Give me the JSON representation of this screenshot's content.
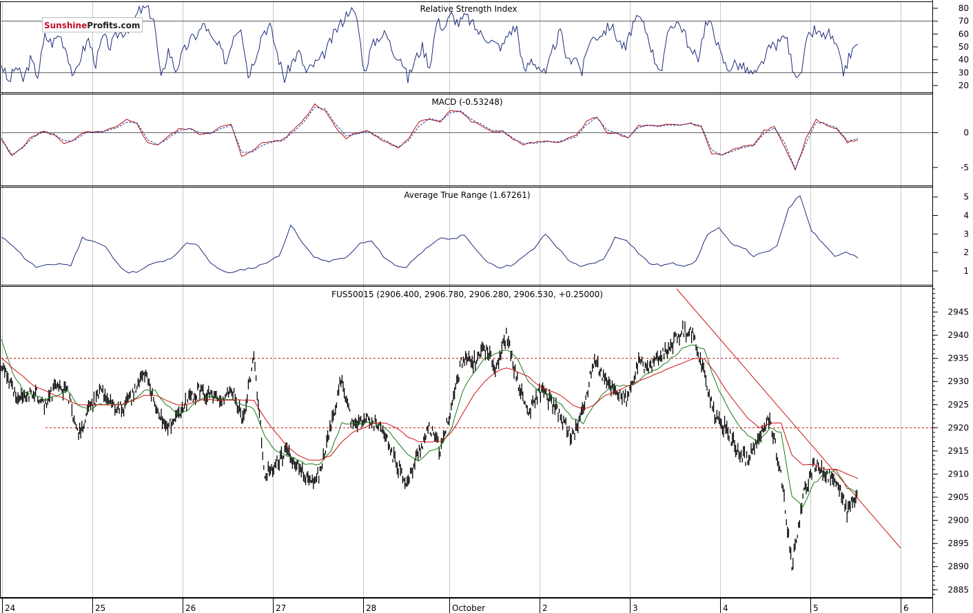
{
  "logo": {
    "part1": "Sunshine",
    "part2": "Profits.com"
  },
  "colors": {
    "price": "#000000",
    "ma_fast": "#1a7a1a",
    "ma_slow": "#cc1111",
    "rsi": "#1b2a7a",
    "macd": "#b01010",
    "signal": "#1a2aa0",
    "atr": "#1b2a7a",
    "grid": "#c8c8c8",
    "level": "#cc1111"
  },
  "x_axis": {
    "labels": [
      "24",
      "25",
      "26",
      "27",
      "28",
      "October",
      "2",
      "3",
      "4",
      "5",
      "6"
    ]
  },
  "chart_data": [
    {
      "type": "line",
      "title": "Relative Strength Index",
      "ylim": [
        20,
        80
      ],
      "yticks": [
        20,
        30,
        40,
        50,
        60,
        70,
        80
      ],
      "levels": [
        30,
        70
      ],
      "series": [
        {
          "values": [
            37,
            22,
            35,
            24,
            40,
            28,
            58,
            53,
            60,
            47,
            25,
            44,
            56,
            37,
            58,
            50,
            60,
            62,
            68,
            78,
            80,
            72,
            24,
            48,
            32,
            45,
            55,
            60,
            68,
            55,
            50,
            38,
            60,
            67,
            28,
            43,
            62,
            66,
            45,
            25,
            38,
            46,
            30,
            36,
            40,
            50,
            62,
            70,
            80,
            72,
            30,
            50,
            58,
            60,
            46,
            42,
            25,
            40,
            50,
            35,
            70,
            65,
            75,
            68,
            74,
            67,
            60,
            57,
            52,
            50,
            62,
            65,
            30,
            40,
            35,
            28,
            48,
            62,
            38,
            44,
            30,
            55,
            58,
            62,
            67,
            55,
            48,
            68,
            72,
            60,
            40,
            32,
            65,
            70,
            63,
            45,
            42,
            68,
            66,
            45,
            33,
            37,
            35,
            30,
            28,
            40,
            50,
            52,
            60,
            35,
            25,
            55,
            63,
            58,
            60,
            50,
            30,
            45,
            52
          ]
        }
      ]
    },
    {
      "type": "line",
      "title": "MACD (-0.53248)",
      "ylim": [
        -7,
        5
      ],
      "yticks": [
        -5,
        0
      ],
      "levels": [
        0
      ],
      "series": [
        {
          "values": [
            -1.0,
            -3.4,
            -2.0,
            -0.5,
            0.2,
            -0.3,
            -1.5,
            -1.0,
            0.1,
            0.0,
            0.3,
            0.8,
            1.8,
            1.3,
            -1.5,
            -1.7,
            -0.5,
            0.5,
            0.6,
            -0.2,
            0.0,
            0.8,
            1.2,
            -3.5,
            -2.5,
            -1.5,
            -1.2,
            -1.0,
            0.5,
            2.0,
            4.1,
            3.2,
            0.8,
            -0.8,
            0.0,
            0.3,
            -0.7,
            -1.5,
            -2.2,
            -0.8,
            1.5,
            2.0,
            1.6,
            3.3,
            3.0,
            1.6,
            1.0,
            0.0,
            0.3,
            -1.0,
            -1.7,
            -1.4,
            -1.3,
            -1.4,
            -1.0,
            -0.4,
            1.5,
            2.3,
            0.0,
            -0.2,
            -0.8,
            1.0,
            1.0,
            0.9,
            1.2,
            1.1,
            1.4,
            0.8,
            -3.0,
            -3.2,
            -2.5,
            -2.0,
            -1.8,
            0.3,
            0.8,
            -2.0,
            -5.5,
            -1.0,
            2.0,
            1.0,
            0.6,
            -1.5,
            -1.0
          ]
        },
        {
          "values": [
            -0.8,
            -3.2,
            -2.2,
            -0.7,
            0.1,
            -0.2,
            -1.2,
            -1.1,
            -0.1,
            0.1,
            0.2,
            0.7,
            1.5,
            1.4,
            -1.0,
            -1.7,
            -0.8,
            0.3,
            0.6,
            0.0,
            -0.1,
            0.6,
            1.1,
            -2.8,
            -2.8,
            -1.8,
            -1.3,
            -1.1,
            0.2,
            1.6,
            3.7,
            3.4,
            1.2,
            -0.5,
            -0.2,
            0.2,
            -0.5,
            -1.3,
            -2.1,
            -1.1,
            1.0,
            2.0,
            1.7,
            2.9,
            3.1,
            1.9,
            1.2,
            0.3,
            0.2,
            -0.8,
            -1.6,
            -1.5,
            -1.3,
            -1.3,
            -1.1,
            -0.6,
            1.1,
            2.2,
            0.4,
            -0.1,
            -0.7,
            0.8,
            1.0,
            0.9,
            1.1,
            1.1,
            1.3,
            1.0,
            -2.5,
            -3.2,
            -2.7,
            -2.1,
            -1.9,
            -0.1,
            0.7,
            -1.5,
            -5.2,
            -1.6,
            1.5,
            1.2,
            0.7,
            -1.2,
            -0.8
          ]
        }
      ]
    },
    {
      "type": "line",
      "title": "Average True Range (1.67261)",
      "ylim": [
        0.4,
        5.4
      ],
      "yticks": [
        1,
        2,
        3,
        4,
        5
      ],
      "series": [
        {
          "values": [
            2.8,
            2.4,
            1.7,
            1.2,
            1.3,
            1.4,
            1.3,
            2.8,
            2.6,
            2.3,
            1.4,
            0.9,
            1.0,
            1.4,
            1.5,
            1.8,
            2.5,
            2.4,
            1.5,
            1.0,
            0.9,
            1.1,
            1.2,
            1.5,
            1.8,
            3.5,
            2.5,
            1.8,
            1.5,
            1.6,
            1.8,
            2.5,
            2.6,
            1.8,
            1.3,
            1.2,
            1.9,
            2.3,
            2.8,
            2.7,
            3.0,
            2.1,
            1.5,
            1.2,
            1.3,
            1.7,
            2.2,
            3.0,
            2.3,
            1.6,
            1.2,
            1.4,
            1.6,
            2.8,
            2.7,
            2.0,
            1.4,
            1.3,
            1.4,
            1.3,
            1.5,
            3.0,
            3.3,
            2.5,
            2.3,
            1.8,
            2.0,
            2.3,
            4.4,
            5.1,
            3.2,
            2.5,
            1.8,
            2.0,
            1.7
          ]
        }
      ]
    },
    {
      "type": "line",
      "title": "FUS50015 (2906.400, 2906.780, 2906.280, 2906.530, +0.25000)",
      "ylim": [
        2884,
        2950
      ],
      "yticks": [
        2885,
        2890,
        2895,
        2900,
        2905,
        2910,
        2915,
        2920,
        2925,
        2930,
        2935,
        2940,
        2945
      ],
      "levels": [
        2935,
        2920
      ],
      "series": [
        {
          "values": [
            2934,
            2928,
            2926,
            2928,
            2925,
            2929,
            2928,
            2918,
            2924,
            2928,
            2925,
            2924,
            2927,
            2932,
            2925,
            2920,
            2922,
            2926,
            2928,
            2927,
            2925,
            2928,
            2922,
            2935,
            2910,
            2912,
            2915,
            2912,
            2908,
            2910,
            2920,
            2931,
            2920,
            2922,
            2921,
            2918,
            2912,
            2908,
            2915,
            2920,
            2915,
            2925,
            2935,
            2934,
            2937,
            2933,
            2940,
            2930,
            2923,
            2928,
            2926,
            2922,
            2918,
            2924,
            2935,
            2930,
            2928,
            2926,
            2934,
            2933,
            2935,
            2938,
            2941,
            2940,
            2932,
            2922,
            2920,
            2915,
            2913,
            2918,
            2922,
            2910,
            2890,
            2905,
            2912,
            2910,
            2909,
            2902,
            2906
          ]
        },
        {
          "values": [
            2939,
            2932,
            2928,
            2927,
            2926,
            2927,
            2928,
            2925,
            2924,
            2925,
            2925,
            2925,
            2926,
            2928,
            2928,
            2925,
            2923,
            2924,
            2926,
            2927,
            2926,
            2926,
            2925,
            2924,
            2918,
            2915,
            2914,
            2913,
            2912,
            2912,
            2915,
            2921,
            2921,
            2921,
            2921,
            2920,
            2917,
            2914,
            2913,
            2915,
            2916,
            2920,
            2928,
            2932,
            2935,
            2936,
            2937,
            2935,
            2930,
            2928,
            2927,
            2925,
            2922,
            2921,
            2925,
            2928,
            2929,
            2929,
            2930,
            2932,
            2933,
            2935,
            2937,
            2938,
            2937,
            2930,
            2925,
            2921,
            2918,
            2917,
            2920,
            2919,
            2905,
            2903,
            2908,
            2910,
            2911,
            2907,
            2906
          ]
        },
        {
          "values": [
            2935,
            2933,
            2931,
            2929,
            2928,
            2927,
            2926,
            2925,
            2925,
            2925,
            2925,
            2925,
            2926,
            2927,
            2927,
            2926,
            2925,
            2925,
            2926,
            2926,
            2926,
            2926,
            2926,
            2926,
            2922,
            2919,
            2916,
            2914,
            2913,
            2913,
            2914,
            2917,
            2919,
            2920,
            2921,
            2921,
            2920,
            2918,
            2917,
            2917,
            2917,
            2919,
            2923,
            2927,
            2930,
            2932,
            2933,
            2932,
            2931,
            2929,
            2928,
            2927,
            2925,
            2924,
            2925,
            2927,
            2928,
            2929,
            2930,
            2931,
            2932,
            2933,
            2934,
            2935,
            2935,
            2932,
            2928,
            2925,
            2922,
            2920,
            2921,
            2921,
            2914,
            2912,
            2912,
            2911,
            2911,
            2910,
            2909
          ]
        }
      ],
      "trendline": [
        2948,
        2894
      ],
      "x_range": [
        0,
        6
      ]
    }
  ]
}
